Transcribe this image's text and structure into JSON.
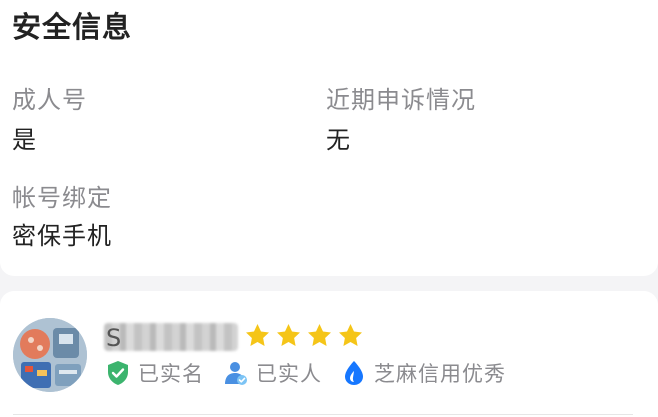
{
  "security": {
    "title": "安全信息",
    "adult_label": "成人号",
    "adult_value": "是",
    "appeal_label": "近期申诉情况",
    "appeal_value": "无",
    "binding_label": "帐号绑定",
    "binding_value": "密保手机"
  },
  "profile": {
    "username_initial": "S",
    "star_rating": 4,
    "star_color": "#f5c518",
    "badges": [
      {
        "icon": "shield-check-icon",
        "label": "已实名",
        "color": "#3cb46e"
      },
      {
        "icon": "person-check-icon",
        "label": "已实人",
        "color": "#4a90e2"
      },
      {
        "icon": "sesame-credit-icon",
        "label": "芝麻信用优秀",
        "color": "#1677ff"
      }
    ]
  }
}
